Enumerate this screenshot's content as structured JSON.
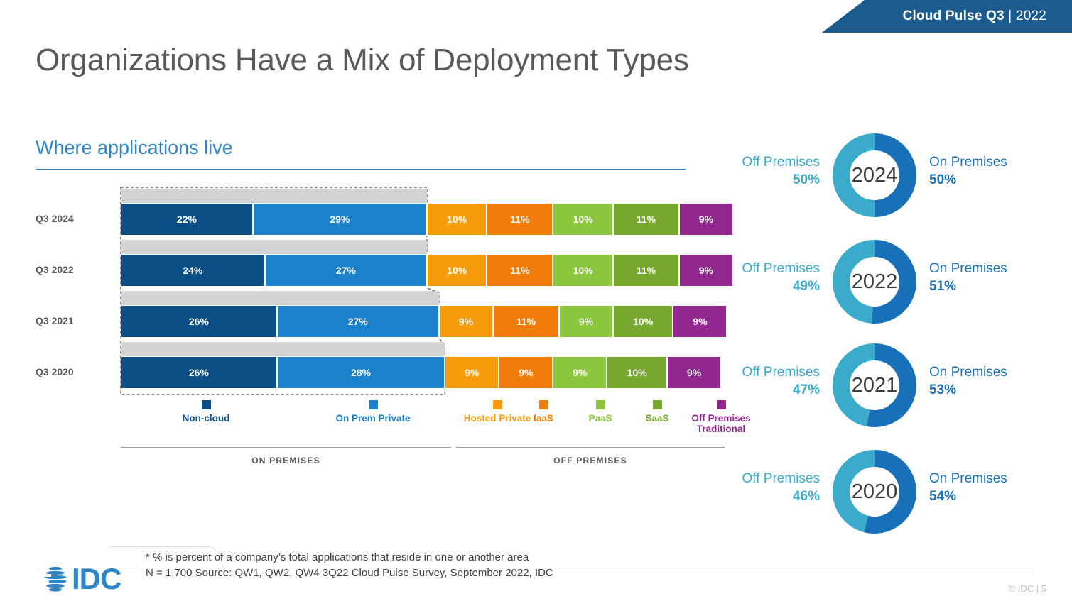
{
  "banner": {
    "title": "Cloud Pulse Q3",
    "separator": "|",
    "year": "2022"
  },
  "page_title": "Organizations Have a Mix of Deployment Types",
  "chart_section": {
    "subtitle": "Where applications live",
    "group_labels": {
      "on_premises": "ON PREMISES",
      "off_premises": "OFF PREMISES"
    }
  },
  "chart_data": {
    "type": "bar",
    "subtype": "stacked-horizontal-100",
    "title": "Where applications live",
    "xlabel": "",
    "ylabel": "",
    "xlim": [
      0,
      102
    ],
    "grid": false,
    "legend_position": "bottom",
    "categories": [
      "Q3 2024",
      "Q3 2022",
      "Q3 2021",
      "Q3 2020"
    ],
    "series": [
      {
        "name": "Non-cloud",
        "group": "ON PREMISES",
        "color": "#0B4F86",
        "values": [
          22,
          24,
          26,
          26
        ]
      },
      {
        "name": "On Prem Private",
        "group": "ON PREMISES",
        "color": "#1B81CB",
        "values": [
          29,
          27,
          27,
          28
        ]
      },
      {
        "name": "Hosted Private",
        "group": "OFF PREMISES",
        "color": "#F59B0C",
        "values": [
          10,
          10,
          9,
          9
        ]
      },
      {
        "name": "IaaS",
        "group": "OFF PREMISES",
        "color": "#F07D09",
        "values": [
          11,
          11,
          11,
          9
        ]
      },
      {
        "name": "PaaS",
        "group": "OFF PREMISES",
        "color": "#8CC63E",
        "values": [
          10,
          10,
          9,
          9
        ]
      },
      {
        "name": "SaaS",
        "group": "OFF PREMISES",
        "color": "#76A82E",
        "values": [
          11,
          11,
          10,
          10
        ]
      },
      {
        "name": "Off Premises Traditional",
        "group": "OFF PREMISES",
        "color": "#92278F",
        "values": [
          9,
          9,
          9,
          9
        ]
      }
    ],
    "value_labels": [
      [
        "22%",
        "29%",
        "10%",
        "11%",
        "10%",
        "11%",
        "9%"
      ],
      [
        "24%",
        "27%",
        "10%",
        "11%",
        "10%",
        "11%",
        "9%"
      ],
      [
        "26%",
        "27%",
        "9%",
        "11%",
        "9%",
        "10%",
        "9%"
      ],
      [
        "26%",
        "28%",
        "9%",
        "9%",
        "9%",
        "10%",
        "9%"
      ]
    ]
  },
  "donuts": {
    "colors": {
      "off_premises": "#3AABCB",
      "on_premises": "#1871B8"
    },
    "items": [
      {
        "year": "2024",
        "off_label": "Off Premises",
        "off_value": "50%",
        "off_pct": 50,
        "on_label": "On Premises",
        "on_value": "50%",
        "on_pct": 50
      },
      {
        "year": "2022",
        "off_label": "Off Premises",
        "off_value": "49%",
        "off_pct": 49,
        "on_label": "On Premises",
        "on_value": "51%",
        "on_pct": 51
      },
      {
        "year": "2021",
        "off_label": "Off Premises",
        "off_value": "47%",
        "off_pct": 47,
        "on_label": "On Premises",
        "on_value": "53%",
        "on_pct": 53
      },
      {
        "year": "2020",
        "off_label": "Off Premises",
        "off_value": "46%",
        "off_pct": 46,
        "on_label": "On Premises",
        "on_value": "54%",
        "on_pct": 54
      }
    ]
  },
  "footer": {
    "note_line1": "* % is percent of a company’s total applications that reside in one or another area",
    "note_line2": "N = 1,700  Source: QW1, QW2, QW4  3Q22 Cloud Pulse Survey, September 2022, IDC",
    "logo_text": "IDC",
    "copyright": "© IDC |",
    "page_number": "5"
  }
}
